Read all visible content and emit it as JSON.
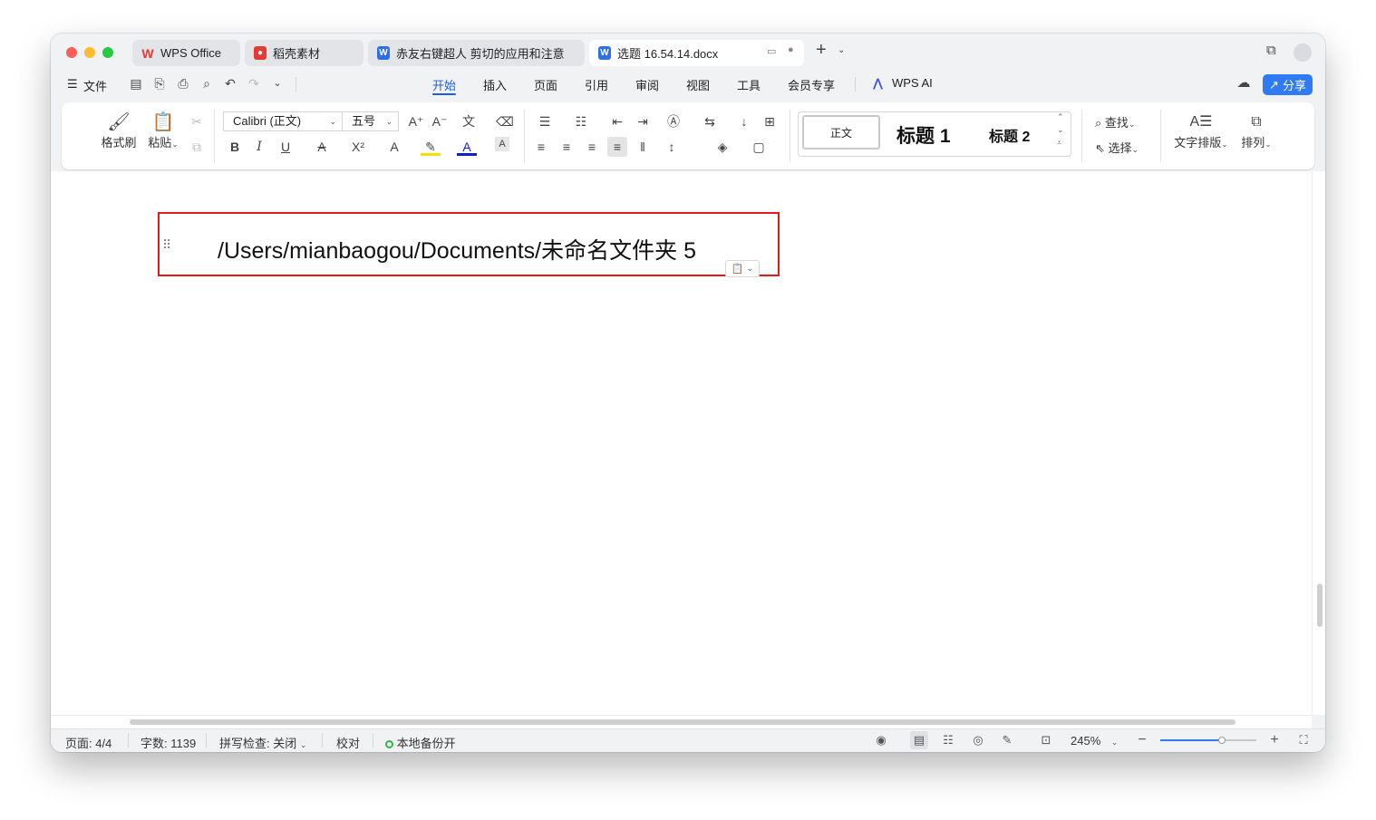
{
  "tabs": [
    {
      "label": "WPS Office",
      "icon": "wps-logo-icon",
      "color": "#e53935"
    },
    {
      "label": "稻壳素材",
      "icon": "docer-icon",
      "color": "#e53935"
    },
    {
      "label": "赤友右键超人 剪切的应用和注意",
      "icon": "word-doc-icon",
      "color": "#2f6fe4"
    },
    {
      "label": "选题 16.54.14.docx",
      "icon": "word-doc-icon",
      "color": "#2f6fe4"
    }
  ],
  "menu": {
    "file_label": "文件",
    "ribbon_tabs": [
      "开始",
      "插入",
      "页面",
      "引用",
      "审阅",
      "视图",
      "工具",
      "会员专享"
    ],
    "active_tab": "开始",
    "wps_ai_label": "WPS AI",
    "share_label": "分享"
  },
  "ribbon": {
    "format_brush_label": "格式刷",
    "paste_label": "粘贴",
    "font_name": "Calibri (正文)",
    "font_size": "五号",
    "style_normal": "正文",
    "style_h1": "标题 1",
    "style_h2": "标题 2",
    "find_label": "查找",
    "select_label": "选择",
    "text_layout_label": "文字排版",
    "arrange_label": "排列"
  },
  "document": {
    "text": "/Users/mianbaogou/Documents/未命名文件夹 5"
  },
  "status": {
    "page": "页面: 4/4",
    "word_count": "字数: 1139",
    "spell_check": "拼写检查: 关闭",
    "proofread": "校对",
    "backup": "本地备份开",
    "zoom": "245%"
  },
  "colors": {
    "accent": "#1f5de0",
    "share_button": "#2f7af5",
    "highlight_border": "#e21b1b",
    "backup_dot": "#2eb84b"
  }
}
